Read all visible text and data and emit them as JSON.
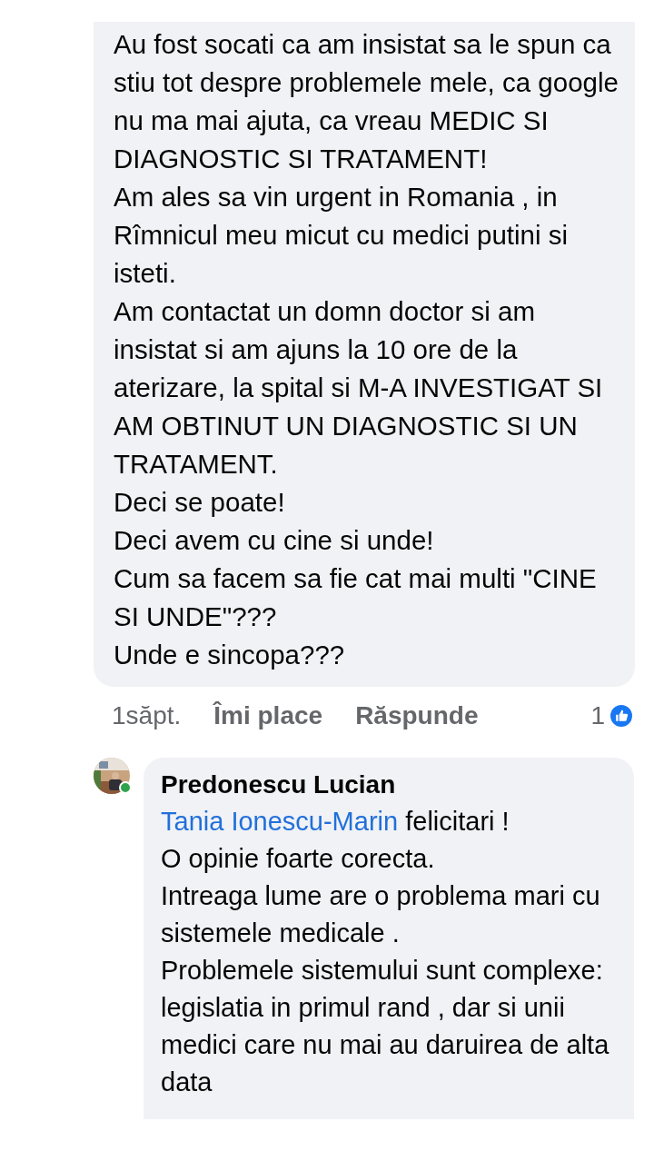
{
  "comments": [
    {
      "paragraphs": [
        "Au fost socati ca am insistat sa le spun ca stiu tot despre problemele mele, ca google nu ma mai ajuta, ca vreau MEDIC  SI DIAGNOSTIC SI TRATAMENT!",
        "Am ales sa vin urgent in Romania , in Rîmnicul meu micut cu medici putini si isteti.",
        "Am contactat un domn doctor si am insistat si am ajuns la 10 ore de la aterizare, la spital si M-A INVESTIGAT SI AM OBTINUT UN DIAGNOSTIC SI UN TRATAMENT.",
        "Deci se poate!",
        "Deci avem cu cine si unde!",
        "Cum sa facem sa fie cat mai multi \"CINE  SI  UNDE\"???",
        "Unde e sincopa???"
      ],
      "time": "1săpt.",
      "like_label": "Îmi place",
      "reply_label": "Răspunde",
      "reaction_count": "1"
    },
    {
      "author": "Predonescu Lucian",
      "online": true,
      "mention": "Tania Ionescu-Marin",
      "paragraphs": [
        "felicitari !",
        "O opinie foarte corecta.",
        "Intreaga lume are o problema mari cu sistemele medicale .",
        "Problemele sistemului sunt complexe: legislatia in primul rand , dar si unii medici care nu mai au daruirea de alta data"
      ]
    }
  ]
}
